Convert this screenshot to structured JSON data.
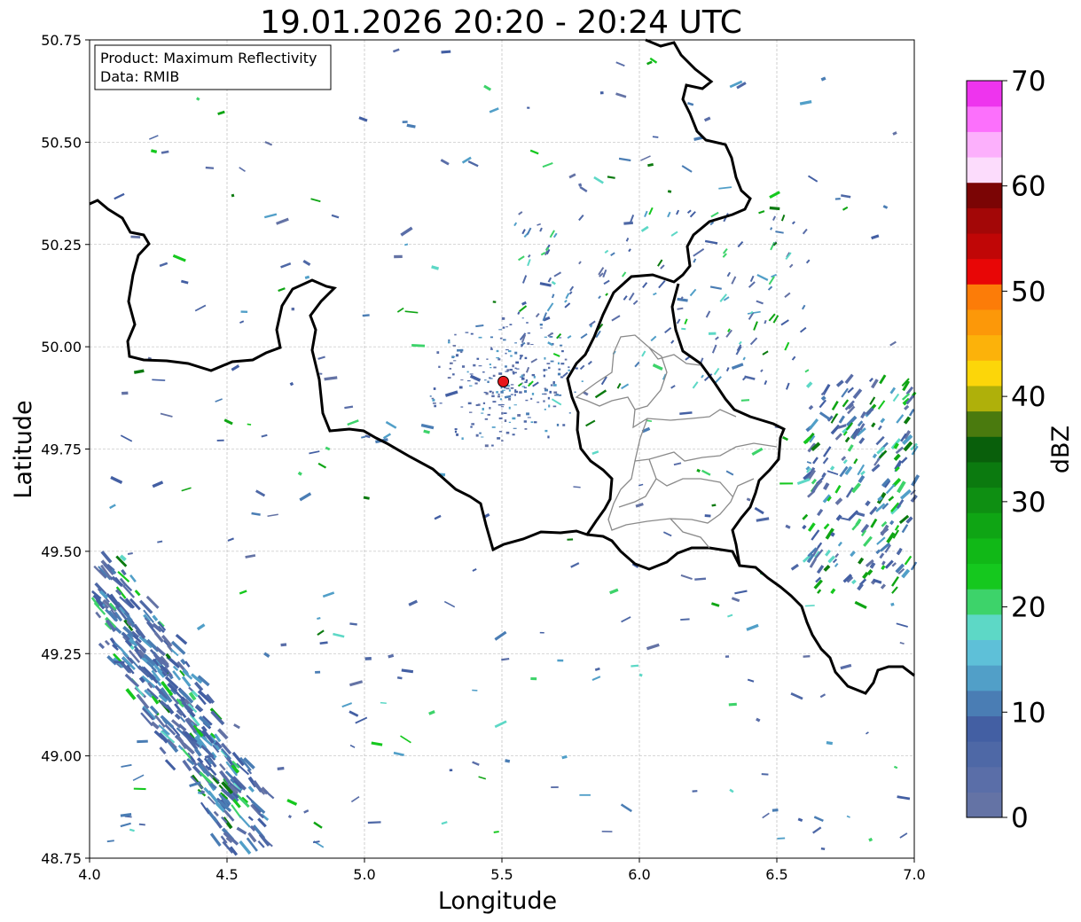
{
  "title": "19.01.2026 20:20 - 20:24 UTC",
  "info": {
    "product_line": "Product: Maximum Reflectivity",
    "data_line": "Data: RMIB"
  },
  "axes": {
    "xlabel": "Longitude",
    "ylabel": "Latitude",
    "xlim": [
      4.0,
      7.0
    ],
    "ylim": [
      48.75,
      50.75
    ],
    "xticks": [
      "4.0",
      "4.5",
      "5.0",
      "5.5",
      "6.0",
      "6.5",
      "7.0"
    ],
    "yticks": [
      "50.75",
      "50.50",
      "50.25",
      "50.00",
      "49.75",
      "49.50",
      "49.25",
      "49.00",
      "48.75"
    ],
    "grid": true
  },
  "radar_site": {
    "lon": 5.505,
    "lat": 49.915,
    "color": "#e8161b"
  },
  "colorbar": {
    "label": "dBZ",
    "min": 0,
    "max": 70,
    "ticks": [
      "0",
      "10",
      "20",
      "30",
      "40",
      "50",
      "60",
      "70"
    ],
    "colors": [
      "#6473a5",
      "#5a6ea8",
      "#4e68a6",
      "#435fa3",
      "#4a7db4",
      "#519fc8",
      "#5ec0d8",
      "#5dd8c6",
      "#3dd36a",
      "#15c81e",
      "#11b817",
      "#0fa514",
      "#0e8f12",
      "#0b7a0f",
      "#095f0b",
      "#4a7a0e",
      "#afb00a",
      "#fcd609",
      "#fcb20a",
      "#fc9809",
      "#fc7c08",
      "#e80606",
      "#c00606",
      "#a30707",
      "#7b0505",
      "#fcdcfc",
      "#fcb0fc",
      "#fc70fc",
      "#ee34ee"
    ]
  }
}
